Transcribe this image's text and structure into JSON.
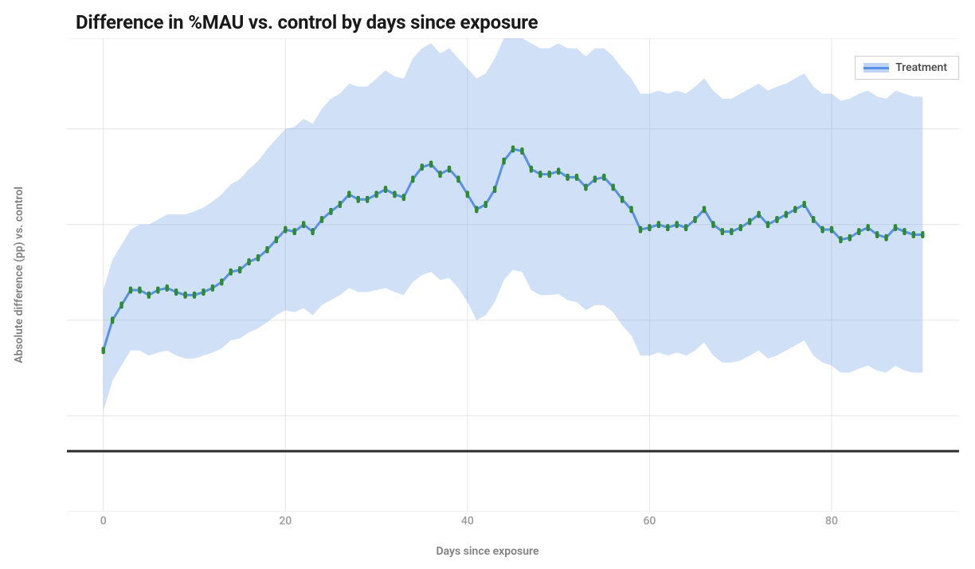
{
  "chart_data": {
    "type": "line",
    "title": "Difference in %MAU vs. control by days since exposure",
    "xlabel": "Days since exposure",
    "ylabel": "Absolute difference (pp) vs. control",
    "xlim": [
      -4,
      94
    ],
    "ylim": [
      -0.6,
      4.1
    ],
    "x_ticks": [
      0,
      20,
      40,
      60,
      80
    ],
    "y_gridlines": [
      -0.6,
      0.35,
      1.3,
      2.25,
      3.2,
      4.1
    ],
    "zero_line_y": 0,
    "legend": {
      "label": "Treatment",
      "position": "top-right"
    },
    "x": [
      0,
      1,
      2,
      3,
      4,
      5,
      6,
      7,
      8,
      9,
      10,
      11,
      12,
      13,
      14,
      15,
      16,
      17,
      18,
      19,
      20,
      21,
      22,
      23,
      24,
      25,
      26,
      27,
      28,
      29,
      30,
      31,
      32,
      33,
      34,
      35,
      36,
      37,
      38,
      39,
      40,
      41,
      42,
      43,
      44,
      45,
      46,
      47,
      48,
      49,
      50,
      51,
      52,
      53,
      54,
      55,
      56,
      57,
      58,
      59,
      60,
      61,
      62,
      63,
      64,
      65,
      66,
      67,
      68,
      69,
      70,
      71,
      72,
      73,
      74,
      75,
      76,
      77,
      78,
      79,
      80,
      81,
      82,
      83,
      84,
      85,
      86,
      87,
      88,
      89,
      90
    ],
    "series": [
      {
        "name": "Treatment",
        "values": [
          1.0,
          1.3,
          1.45,
          1.6,
          1.6,
          1.55,
          1.6,
          1.62,
          1.58,
          1.55,
          1.55,
          1.58,
          1.62,
          1.68,
          1.78,
          1.8,
          1.88,
          1.92,
          2.0,
          2.1,
          2.2,
          2.18,
          2.25,
          2.18,
          2.3,
          2.38,
          2.45,
          2.55,
          2.5,
          2.5,
          2.55,
          2.6,
          2.55,
          2.52,
          2.7,
          2.82,
          2.85,
          2.75,
          2.8,
          2.7,
          2.55,
          2.4,
          2.45,
          2.6,
          2.88,
          3.0,
          2.98,
          2.8,
          2.75,
          2.75,
          2.78,
          2.72,
          2.72,
          2.62,
          2.7,
          2.72,
          2.62,
          2.5,
          2.4,
          2.2,
          2.22,
          2.25,
          2.22,
          2.25,
          2.22,
          2.3,
          2.4,
          2.25,
          2.18,
          2.18,
          2.22,
          2.28,
          2.35,
          2.25,
          2.3,
          2.35,
          2.4,
          2.45,
          2.3,
          2.2,
          2.2,
          2.1,
          2.12,
          2.18,
          2.22,
          2.15,
          2.12,
          2.22,
          2.18,
          2.15,
          2.15
        ]
      }
    ],
    "band": {
      "upper": [
        1.6,
        1.9,
        2.05,
        2.2,
        2.25,
        2.25,
        2.3,
        2.35,
        2.35,
        2.35,
        2.38,
        2.42,
        2.48,
        2.55,
        2.65,
        2.7,
        2.8,
        2.88,
        3.0,
        3.1,
        3.2,
        3.22,
        3.3,
        3.25,
        3.4,
        3.5,
        3.55,
        3.65,
        3.62,
        3.62,
        3.7,
        3.78,
        3.72,
        3.7,
        3.9,
        4.0,
        4.05,
        3.95,
        4.0,
        3.9,
        3.8,
        3.7,
        3.75,
        3.9,
        4.1,
        4.1,
        4.1,
        4.05,
        4.0,
        4.0,
        4.05,
        4.0,
        4.0,
        3.92,
        4.0,
        4.0,
        3.92,
        3.8,
        3.7,
        3.55,
        3.55,
        3.58,
        3.55,
        3.58,
        3.55,
        3.62,
        3.7,
        3.58,
        3.5,
        3.5,
        3.55,
        3.6,
        3.65,
        3.58,
        3.62,
        3.65,
        3.7,
        3.75,
        3.62,
        3.55,
        3.55,
        3.48,
        3.5,
        3.55,
        3.58,
        3.52,
        3.5,
        3.58,
        3.55,
        3.52,
        3.52
      ],
      "lower": [
        0.4,
        0.7,
        0.85,
        1.0,
        1.0,
        0.95,
        0.98,
        1.0,
        0.95,
        0.92,
        0.92,
        0.95,
        0.98,
        1.02,
        1.1,
        1.12,
        1.18,
        1.22,
        1.28,
        1.35,
        1.4,
        1.38,
        1.42,
        1.35,
        1.45,
        1.5,
        1.55,
        1.62,
        1.58,
        1.58,
        1.6,
        1.62,
        1.58,
        1.55,
        1.68,
        1.75,
        1.78,
        1.7,
        1.72,
        1.62,
        1.48,
        1.3,
        1.35,
        1.48,
        1.7,
        1.8,
        1.78,
        1.6,
        1.55,
        1.55,
        1.56,
        1.5,
        1.48,
        1.4,
        1.45,
        1.45,
        1.38,
        1.25,
        1.15,
        0.95,
        0.95,
        0.98,
        0.95,
        0.98,
        0.95,
        1.0,
        1.08,
        0.95,
        0.88,
        0.88,
        0.9,
        0.95,
        1.0,
        0.92,
        0.95,
        1.0,
        1.05,
        1.1,
        0.95,
        0.88,
        0.85,
        0.78,
        0.78,
        0.82,
        0.85,
        0.8,
        0.78,
        0.85,
        0.8,
        0.78,
        0.78
      ]
    }
  }
}
